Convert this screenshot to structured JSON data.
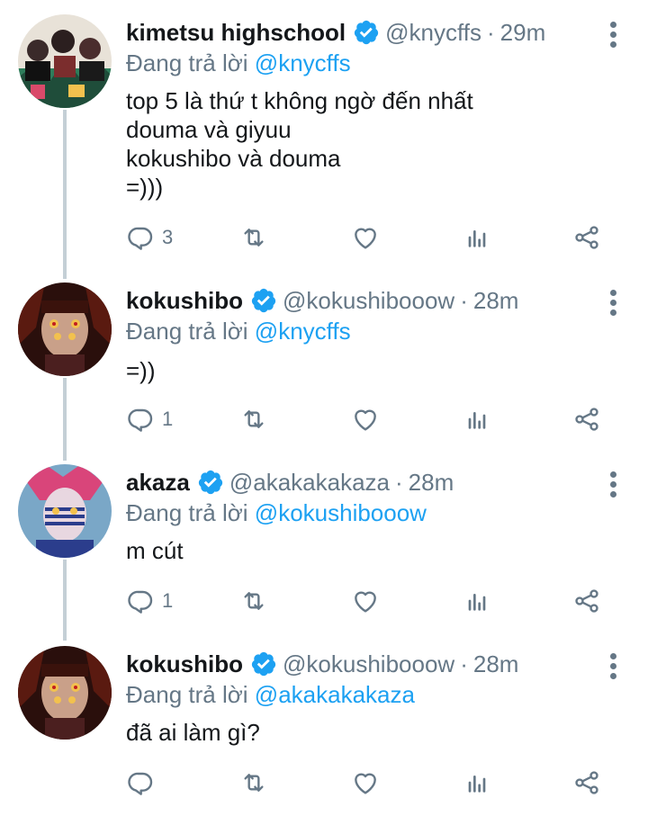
{
  "reply_prefix": "Đang trả lời",
  "colors": {
    "accent": "#1da1f2",
    "muted": "#657786",
    "text": "#14171a",
    "thread_line": "#c4cfd6"
  },
  "tweets": [
    {
      "name": "kimetsu highschool",
      "handle": "@knycffs",
      "dot": "·",
      "time": "29m",
      "replying_to": "@knycffs",
      "lines": [
        "top 5 là thứ t không ngờ đến nhất",
        "douma và giyuu",
        "kokushibo và douma",
        "=)))"
      ],
      "replies": "3"
    },
    {
      "name": "kokushibo",
      "handle": "@kokushibooow",
      "dot": "·",
      "time": "28m",
      "replying_to": "@knycffs",
      "lines": [
        "=))"
      ],
      "replies": "1"
    },
    {
      "name": "akaza",
      "handle": "@akakakakaza",
      "dot": "·",
      "time": "28m",
      "replying_to": "@kokushibooow",
      "lines": [
        "m cút"
      ],
      "replies": "1"
    },
    {
      "name": "kokushibo",
      "handle": "@kokushibooow",
      "dot": "·",
      "time": "28m",
      "replying_to": "@akakakakaza",
      "lines": [
        "đã ai làm gì?"
      ],
      "replies": ""
    }
  ],
  "icons": {
    "reply": "reply-icon",
    "retweet": "retweet-icon",
    "like": "heart-icon",
    "analytics": "analytics-icon",
    "share": "share-icon",
    "verified": "verified-badge-icon",
    "more": "more-vertical-icon"
  }
}
